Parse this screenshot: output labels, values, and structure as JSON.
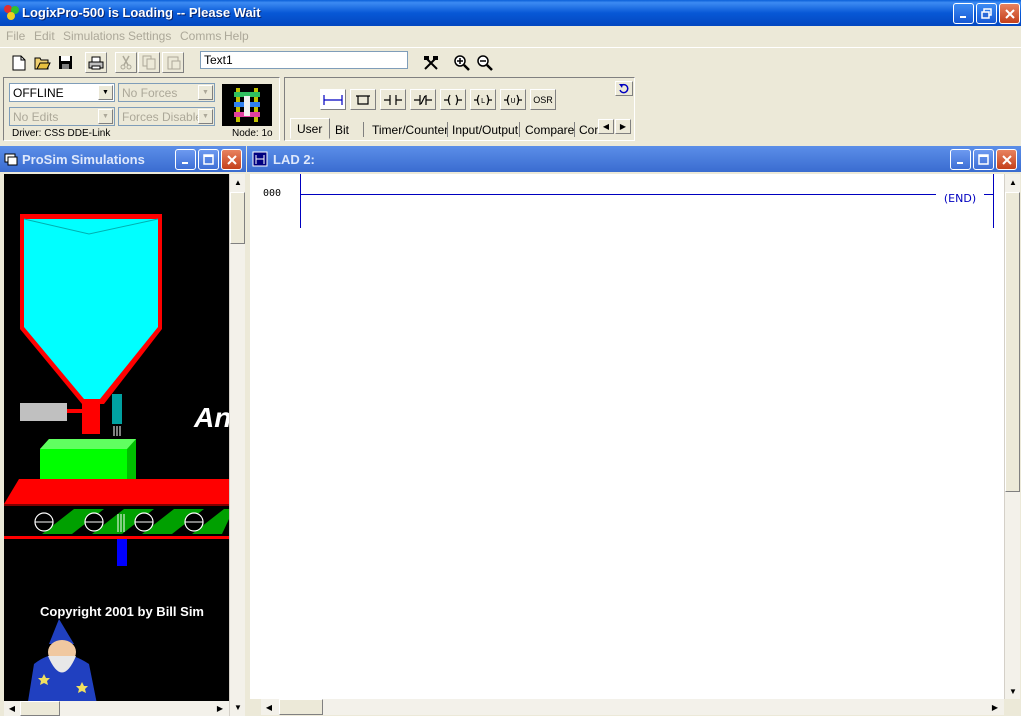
{
  "window": {
    "title": "LogixPro-500 is Loading -- Please Wait"
  },
  "menu": [
    "File",
    "Edit",
    "Simulations",
    "Settings",
    "Comms",
    "Help"
  ],
  "toolbar": {
    "text_field_value": "Text1",
    "icons": [
      "new-file-icon",
      "open-folder-icon",
      "save-icon",
      "print-icon",
      "cut-icon",
      "copy-icon",
      "paste-icon",
      "tools-icon",
      "zoom-in-icon",
      "zoom-out-icon"
    ]
  },
  "status": {
    "mode": "OFFLINE",
    "forces": "No Forces",
    "edits": "No Edits",
    "forces_state": "Forces Disabled",
    "driver": "Driver: CSS DDE-Link",
    "node": "Node: 1o"
  },
  "palette": {
    "osr_label": "OSR",
    "tabs": [
      "User",
      "Bit",
      "Timer/Counter",
      "Input/Output",
      "Compare",
      "Con"
    ]
  },
  "prosim": {
    "title": "ProSim Simulations",
    "banner_text": "An",
    "copyright": "Copyright 2001 by Bill Sim"
  },
  "lad": {
    "title": "LAD 2:",
    "rung_number": "000",
    "end_label": "END"
  },
  "colors": {
    "titlebar": "#0758d6",
    "rung_blue": "#0000c0",
    "hopper_cyan": "#00ffff",
    "box_green": "#00ff00",
    "conveyor_red": "#ff0000"
  }
}
